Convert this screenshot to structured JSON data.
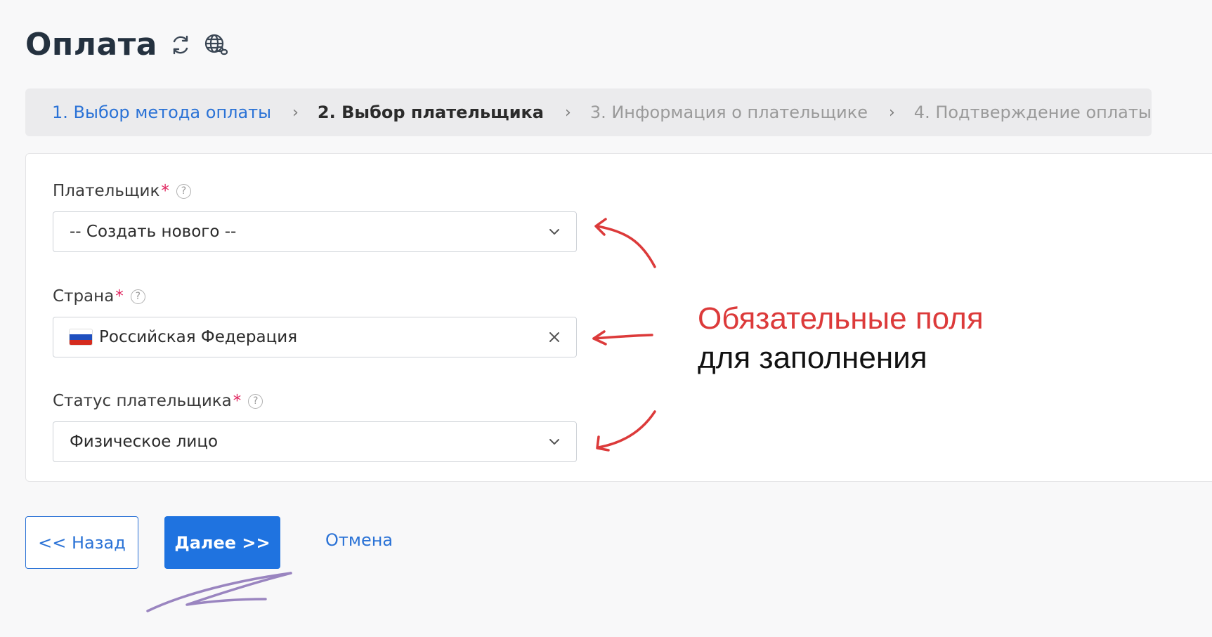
{
  "header": {
    "title": "Оплата",
    "icons": [
      "refresh-icon",
      "globe-link-icon"
    ]
  },
  "stepper": {
    "steps": [
      {
        "label": "1. Выбор метода оплаты",
        "state": "done"
      },
      {
        "label": "2. Выбор плательщика",
        "state": "active"
      },
      {
        "label": "3. Информация о плательщике",
        "state": "todo"
      },
      {
        "label": "4. Подтверждение оплаты",
        "state": "todo"
      }
    ],
    "separator": "›"
  },
  "form": {
    "payer": {
      "label": "Плательщик",
      "required_mark": "*",
      "help": "?",
      "value": "-- Создать нового --",
      "control": "select"
    },
    "country": {
      "label": "Страна",
      "required_mark": "*",
      "help": "?",
      "value": "Российская Федерация",
      "flag": "russia-flag-icon",
      "control": "select-clearable"
    },
    "status": {
      "label": "Статус плательщика",
      "required_mark": "*",
      "help": "?",
      "value": "Физическое лицо",
      "control": "select"
    }
  },
  "annotation": {
    "line1": "Обязательные поля",
    "line2": "для заполнения"
  },
  "actions": {
    "back_label": "<< Назад",
    "next_label": "Далее >>",
    "cancel_label": "Отмена"
  },
  "colors": {
    "accent": "#1f73e0",
    "link": "#2a72d6",
    "required": "#e0245e",
    "annotation_red": "#dc3a3a",
    "annotation_purple": "#9a85c0"
  }
}
